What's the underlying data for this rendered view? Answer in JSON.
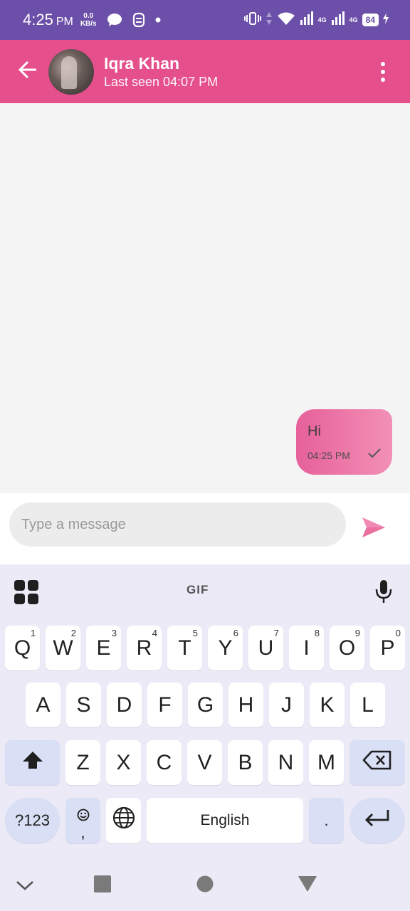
{
  "status_bar": {
    "time": "4:25",
    "ampm": "PM",
    "net_speed_value": "0.0",
    "net_speed_unit": "KB/s",
    "signal_1_label": "4G",
    "signal_2_label": "4G",
    "battery": "84"
  },
  "header": {
    "contact_name": "Iqra Khan",
    "last_seen": "Last seen 04:07 PM"
  },
  "messages": [
    {
      "text": "Hi",
      "time": "04:25 PM",
      "status": "sent"
    }
  ],
  "input": {
    "placeholder": "Type a message",
    "value": ""
  },
  "keyboard": {
    "gif_label": "GIF",
    "row1": [
      "Q",
      "W",
      "E",
      "R",
      "T",
      "Y",
      "U",
      "I",
      "O",
      "P"
    ],
    "row1_numbers": [
      "1",
      "2",
      "3",
      "4",
      "5",
      "6",
      "7",
      "8",
      "9",
      "0"
    ],
    "row2": [
      "A",
      "S",
      "D",
      "F",
      "G",
      "H",
      "J",
      "K",
      "L"
    ],
    "row3": [
      "Z",
      "X",
      "C",
      "V",
      "B",
      "N",
      "M"
    ],
    "symbols_label": "?123",
    "comma_label": ",",
    "space_label": "English",
    "period_label": "."
  },
  "colors": {
    "status_bar": "#6b4fa8",
    "header": "#e44f8c",
    "bubble_start": "#e6609a",
    "bubble_end": "#f290b6",
    "send_icon": "#f08ab2",
    "keyboard_bg": "#eceaf7"
  },
  "icons": {
    "back": "arrow-left-icon",
    "more": "more-vertical-icon",
    "send": "send-icon",
    "check": "check-icon",
    "apps": "apps-grid-icon",
    "mic": "microphone-icon",
    "shift": "shift-icon",
    "backspace": "backspace-icon",
    "emoji": "emoji-icon",
    "globe": "globe-icon",
    "enter": "enter-icon"
  }
}
